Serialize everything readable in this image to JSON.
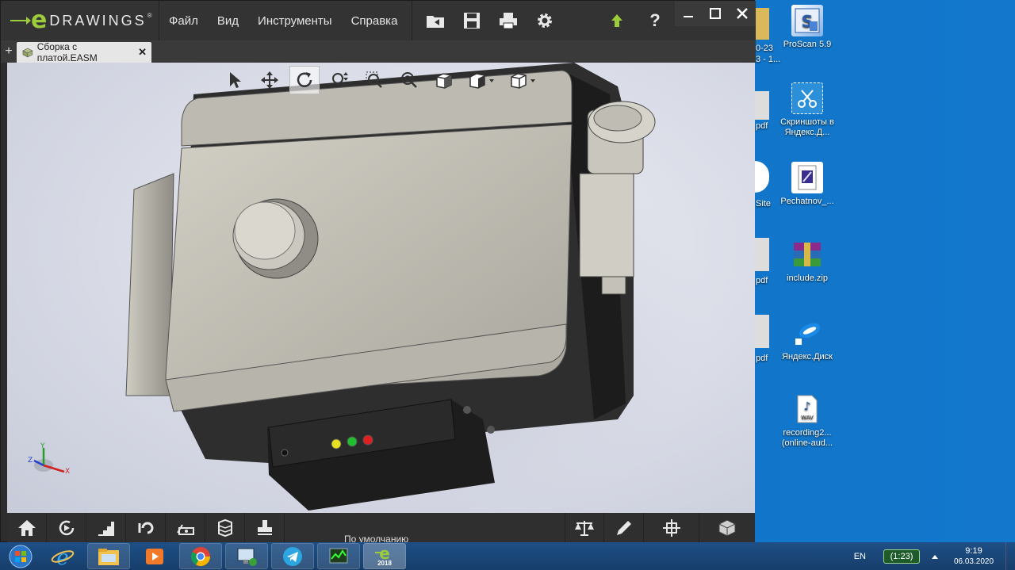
{
  "app": {
    "logo_e": "e",
    "logo_name": "DRAWINGS",
    "menu": [
      "Файл",
      "Вид",
      "Инструменты",
      "Справка"
    ],
    "tab_add": "+",
    "document_tab": "Сборка с платой.EASM",
    "tab_close": "✕",
    "configuration": "По умолчанию",
    "help_glyph": "?"
  },
  "axis": {
    "y": "Y",
    "z": "Z",
    "x": "X"
  },
  "desktop": {
    "icons": [
      {
        "label": "ProScan 5.9"
      },
      {
        "label": "Скриншоты в Яндекс.Д..."
      },
      {
        "label": "Pechatnov_..."
      },
      {
        "label": "include.zip"
      },
      {
        "label": "Яндекс.Диск"
      },
      {
        "label": "recording2... (online-aud..."
      }
    ],
    "partial": [
      "0-23",
      "3 - 1...",
      "pdf",
      "Site",
      "pdf",
      "pdf"
    ]
  },
  "taskbar": {
    "edrawings_label": "2018",
    "language": "EN",
    "battery": "(1:23)",
    "time": "9:19",
    "date": "06.03.2020"
  },
  "colors": {
    "accent": "#9ccc3c",
    "titlebar": "#333333",
    "desktop": "#0f73c8"
  }
}
